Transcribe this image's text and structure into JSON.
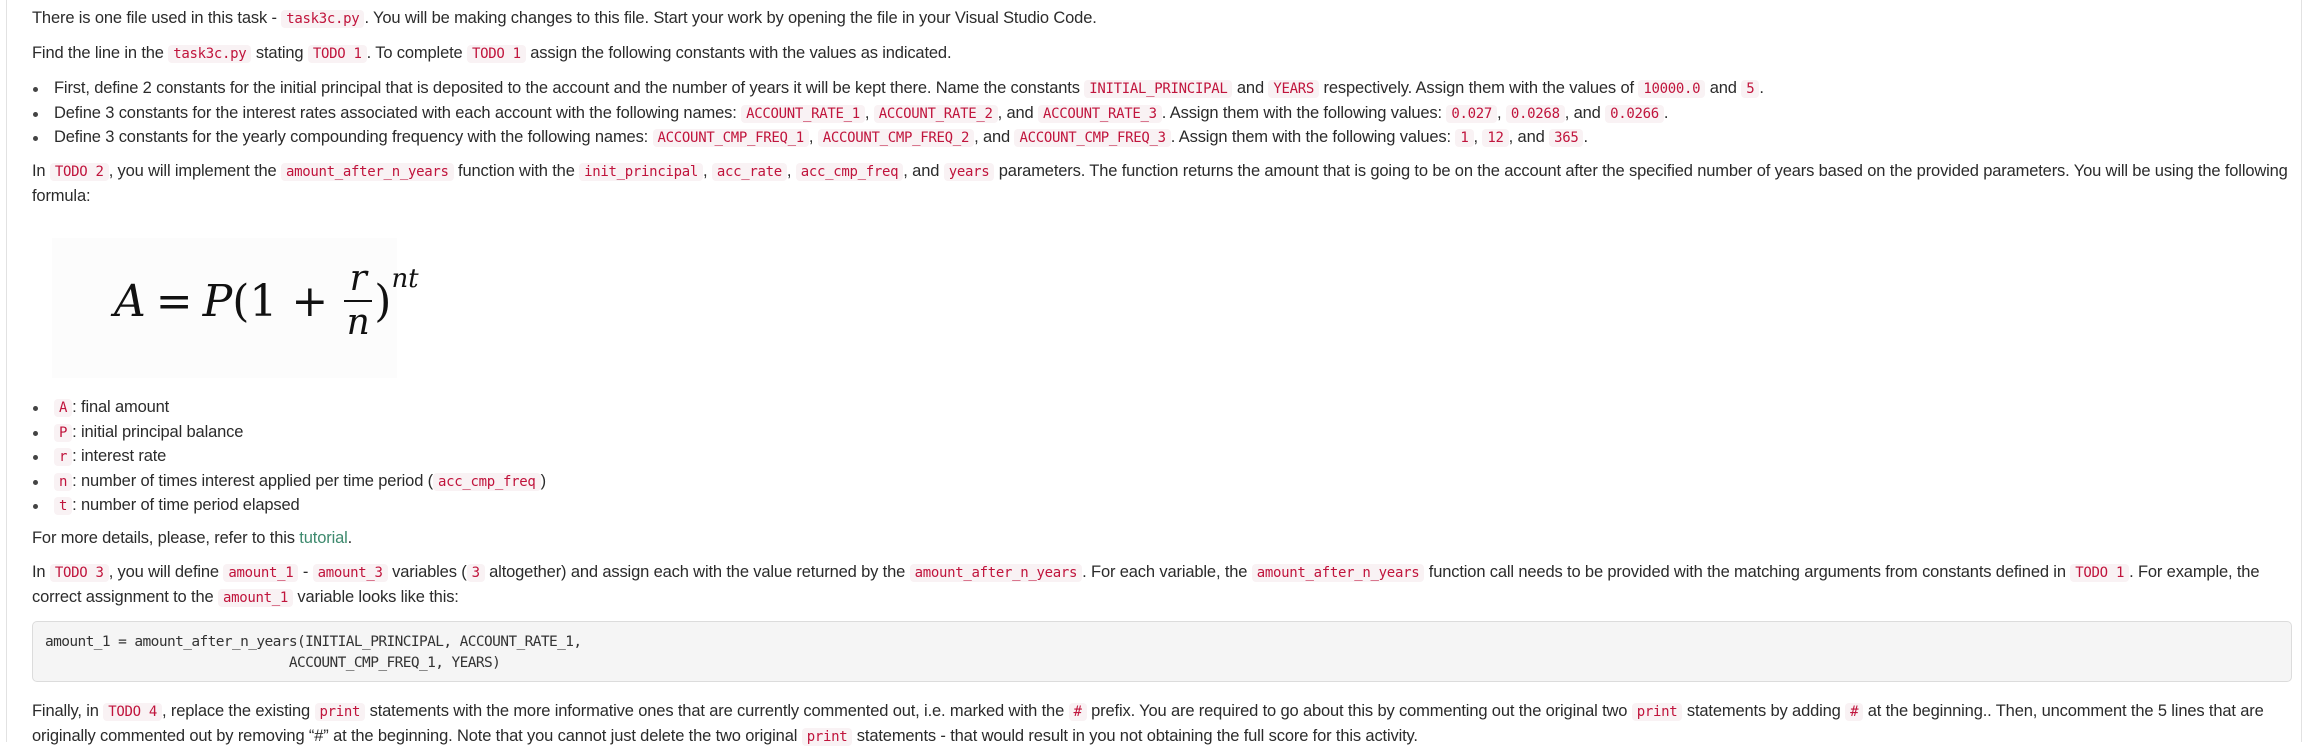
{
  "intro": {
    "t1": "There is one file used in this task - ",
    "file": "task3c.py",
    "t2": ". You will be making changes to this file. Start your work by opening the file in your Visual Studio Code."
  },
  "todo1_intro": {
    "t1": "Find the line in the ",
    "file": "task3c.py",
    "t2": " stating ",
    "todo": "TODO 1",
    "t3": ". To complete ",
    "todo2": "TODO 1",
    "t4": " assign the following constants with the values as indicated."
  },
  "todo1_items": [
    {
      "t1": "First, define 2 constants for the initial principal that is deposited to the account and the number of years it will be kept there. Name the constants ",
      "c1": "INITIAL_PRINCIPAL",
      "t2": " and ",
      "c2": "YEARS",
      "t3": " respectively. Assign them with the values of ",
      "c3": "10000.0",
      "t4": " and ",
      "c4": "5",
      "t5": "."
    },
    {
      "t1": "Define 3 constants for the interest rates associated with each account with the following names: ",
      "c1": "ACCOUNT_RATE_1",
      "t2": ", ",
      "c2": "ACCOUNT_RATE_2",
      "t3": ", and ",
      "c3": "ACCOUNT_RATE_3",
      "t4": ". Assign them with the following values: ",
      "c4": "0.027",
      "t5": ", ",
      "c5": "0.0268",
      "t6": ", and ",
      "c6": "0.0266",
      "t7": "."
    },
    {
      "t1": "Define 3 constants for the yearly compounding frequency with the following names: ",
      "c1": "ACCOUNT_CMP_FREQ_1",
      "t2": ", ",
      "c2": "ACCOUNT_CMP_FREQ_2",
      "t3": ", and ",
      "c3": "ACCOUNT_CMP_FREQ_3",
      "t4": ". Assign them with the following values: ",
      "c4": "1",
      "t5": ", ",
      "c5": "12",
      "t6": ", and ",
      "c6": "365",
      "t7": "."
    }
  ],
  "todo2": {
    "t1": "In ",
    "todo": "TODO 2",
    "t2": ", you will implement the ",
    "c1": "amount_after_n_years",
    "t3": " function with the ",
    "c2": "init_principal",
    "t4": ", ",
    "c3": "acc_rate",
    "t5": ", ",
    "c4": "acc_cmp_freq",
    "t6": ", and ",
    "c5": "years",
    "t7": " parameters. The function returns the amount that is going to be on the account after the specified number of years based on the provided parameters. You will be using the following formula:"
  },
  "formula": {
    "lhs": "A",
    "eq": "=",
    "p": "P",
    "open": "(1 + ",
    "num": "r",
    "den": "n",
    "close": ")",
    "exp": "nt"
  },
  "variables": [
    {
      "sym": "A",
      "desc": ": final amount"
    },
    {
      "sym": "P",
      "desc": ": initial principal balance"
    },
    {
      "sym": "r",
      "desc": ": interest rate"
    },
    {
      "sym": "n",
      "desc": ": number of times interest applied per time period (",
      "code": "acc_cmp_freq",
      "after": ")"
    },
    {
      "sym": "t",
      "desc": ": number of time period elapsed"
    }
  ],
  "details": {
    "t1": "For more details, please, refer to this ",
    "link": "tutorial",
    "t2": "."
  },
  "todo3": {
    "t1": "In ",
    "todo": "TODO 3",
    "t2": ", you will define ",
    "c1": "amount_1",
    "t3": " - ",
    "c2": "amount_3",
    "t4": " variables (",
    "c3": "3",
    "t5": " altogether) and assign each with the value returned by the ",
    "c4": "amount_after_n_years",
    "t6": ". For each variable, the ",
    "c5": "amount_after_n_years",
    "t7": " function call needs to be provided with the matching arguments from constants defined in ",
    "c6": "TODO 1",
    "t8": ". For example, the correct assignment to the ",
    "c7": "amount_1",
    "t9": " variable looks like this:"
  },
  "code_example": "amount_1 = amount_after_n_years(INITIAL_PRINCIPAL, ACCOUNT_RATE_1,\n                              ACCOUNT_CMP_FREQ_1, YEARS)",
  "todo4": {
    "t1": "Finally, in ",
    "todo": "TODO 4",
    "t2": ", replace the existing ",
    "c1": "print",
    "t3": " statements with the more informative ones that are currently commented out, i.e. marked with the ",
    "c2": "#",
    "t4": " prefix. You are required to go about this by commenting out the original two ",
    "c3": "print",
    "t5": " statements by adding ",
    "c4": "#",
    "t6": " at the beginning.. Then, uncomment the 5 lines that are originally commented out by removing “#” at the beginning. Note that you cannot just delete the two original ",
    "c5": "print",
    "t7": " statements - that would result in you not obtaining the full score for this activity."
  }
}
